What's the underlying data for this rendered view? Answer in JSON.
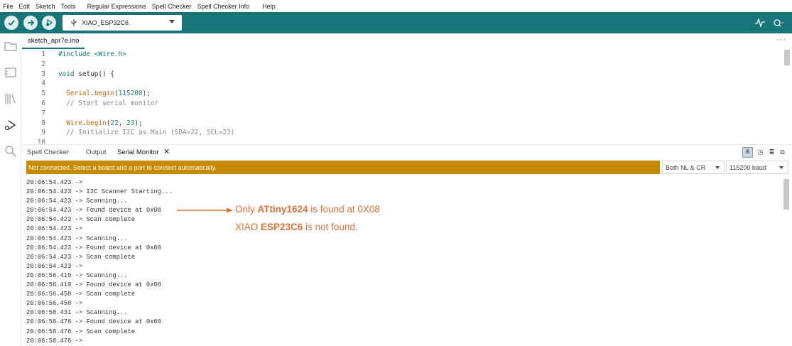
{
  "menu": [
    "File",
    "Edit",
    "Sketch",
    "Tools",
    "Regular Expressions",
    "Spell Checker",
    "Spell Checker Info",
    "Help"
  ],
  "toolbar": {
    "board_name": "XIAO_ESP32C6",
    "verify_icon": "check-icon",
    "upload_icon": "arrow-right-icon",
    "debug_icon": "debugger-icon",
    "plotter_icon": "serial-plotter-icon",
    "monitor_icon": "serial-monitor-icon",
    "accent_color": "#17757a"
  },
  "sidebar": {
    "icons": [
      "folder-icon",
      "boards-manager-icon",
      "library-icon",
      "debug-icon",
      "search-icon"
    ]
  },
  "editor": {
    "file_tab": "sketch_apr7e.ino",
    "more": "···",
    "lines": [
      {
        "num": "1",
        "parts": [
          {
            "t": "#include <Wire.h>",
            "c": "kw"
          }
        ]
      },
      {
        "num": "2",
        "parts": []
      },
      {
        "num": "3",
        "parts": [
          {
            "t": "void",
            "c": "kw"
          },
          {
            "t": " setup() {",
            "c": ""
          }
        ]
      },
      {
        "num": "4",
        "parts": []
      },
      {
        "num": "5",
        "parts": [
          {
            "t": "  Serial",
            "c": "fn"
          },
          {
            "t": ".",
            "c": ""
          },
          {
            "t": "begin",
            "c": "fn"
          },
          {
            "t": "(",
            "c": ""
          },
          {
            "t": "115200",
            "c": "num"
          },
          {
            "t": ");",
            "c": ""
          }
        ]
      },
      {
        "num": "6",
        "parts": [
          {
            "t": "  // Start serial monitor",
            "c": "cm"
          }
        ]
      },
      {
        "num": "7",
        "parts": []
      },
      {
        "num": "8",
        "parts": [
          {
            "t": "  Wire",
            "c": "fn"
          },
          {
            "t": ".",
            "c": ""
          },
          {
            "t": "begin",
            "c": "fn"
          },
          {
            "t": "(",
            "c": ""
          },
          {
            "t": "22",
            "c": "num"
          },
          {
            "t": ", ",
            "c": ""
          },
          {
            "t": "23",
            "c": "num"
          },
          {
            "t": ");",
            "c": ""
          }
        ]
      },
      {
        "num": "9",
        "parts": [
          {
            "t": "  // Initialize I2C as Main (SDA=22, SCL=23)",
            "c": "cm"
          }
        ]
      },
      {
        "num": "10",
        "parts": []
      }
    ]
  },
  "panel": {
    "tabs": [
      "Spell Checker",
      "Output",
      "Serial Monitor"
    ],
    "close": "✕",
    "status_message": "Not connected. Select a board and a port to connect automatically.",
    "line_ending": "Both NL & CR",
    "baud": "115200 baud",
    "status_color": "#c68a00"
  },
  "serial_lines": [
    "20:06:54.423 ->",
    "20:06:54.423 -> I2C Scanner Starting...",
    "20:06:54.423 -> Scanning...",
    "20:06:54.423 -> Found device at 0x08",
    "20:06:54.423 -> Scan complete",
    "20:06:54.423 ->",
    "20:06:54.423 -> Scanning...",
    "20:06:54.423 -> Found device at 0x08",
    "20:06:54.423 -> Scan complete",
    "20:06:54.423 ->",
    "20:06:56.419 -> Scanning...",
    "20:06:56.419 -> Found device at 0x08",
    "20:06:56.458 -> Scan complete",
    "20:06:56.458 ->",
    "20:06:58.431 -> Scanning...",
    "20:06:58.476 -> Found device at 0x08",
    "20:06:58.476 -> Scan complete",
    "20:06:58.476 ->"
  ],
  "annotation": {
    "line1_pre": "Only ",
    "line1_bold": "ATtiny1624",
    "line1_post": " is found at 0X08",
    "line2_pre": "XIAO ",
    "line2_bold": "ESP23C6",
    "line2_post": " is not found.",
    "color": "#e0703a"
  }
}
